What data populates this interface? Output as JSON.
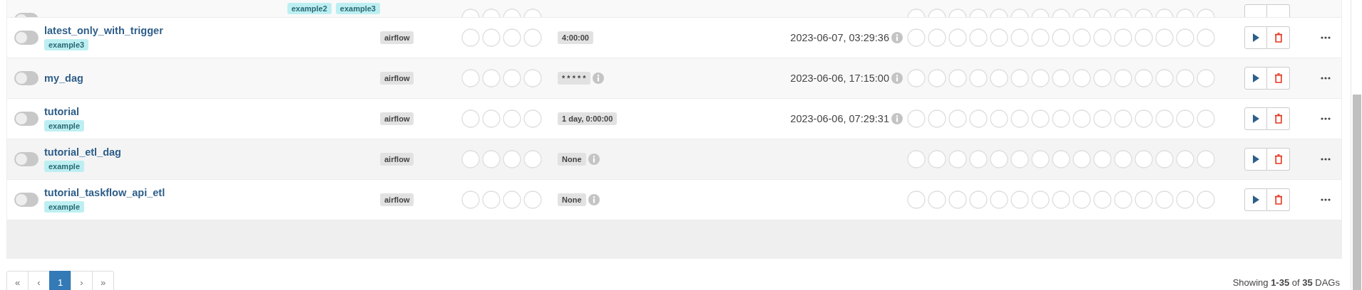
{
  "partial_row": {
    "on": false,
    "tags": [
      "example2",
      "example3"
    ]
  },
  "dags": [
    {
      "name": "latest_only_with_trigger",
      "on": false,
      "tags": [
        "example3"
      ],
      "owner": "airflow",
      "schedule": "4:00:00",
      "schedule_info": false,
      "last_run": "2023-06-07, 03:29:36"
    },
    {
      "name": "my_dag",
      "on": false,
      "owner": "airflow",
      "schedule": "* * * * *",
      "schedule_info": true,
      "last_run": "2023-06-06, 17:15:00"
    },
    {
      "name": "tutorial",
      "on": false,
      "tags": [
        "example"
      ],
      "owner": "airflow",
      "schedule": "1 day, 0:00:00",
      "schedule_info": false,
      "last_run": "2023-06-06, 07:29:31"
    },
    {
      "name": "tutorial_etl_dag",
      "on": false,
      "tags": [
        "example"
      ],
      "owner": "airflow",
      "schedule": "None",
      "schedule_info": true
    },
    {
      "name": "tutorial_taskflow_api_etl",
      "on": false,
      "tags": [
        "example"
      ],
      "owner": "airflow",
      "schedule": "None",
      "schedule_info": true
    }
  ],
  "pagination": [
    {
      "label": "«",
      "selected": false
    },
    {
      "label": "‹",
      "selected": false
    },
    {
      "label": "1",
      "selected": true
    },
    {
      "label": "›",
      "selected": false
    },
    {
      "label": "»",
      "selected": false
    }
  ],
  "summary": "Showing **1-35** of **35** DAGs"
}
